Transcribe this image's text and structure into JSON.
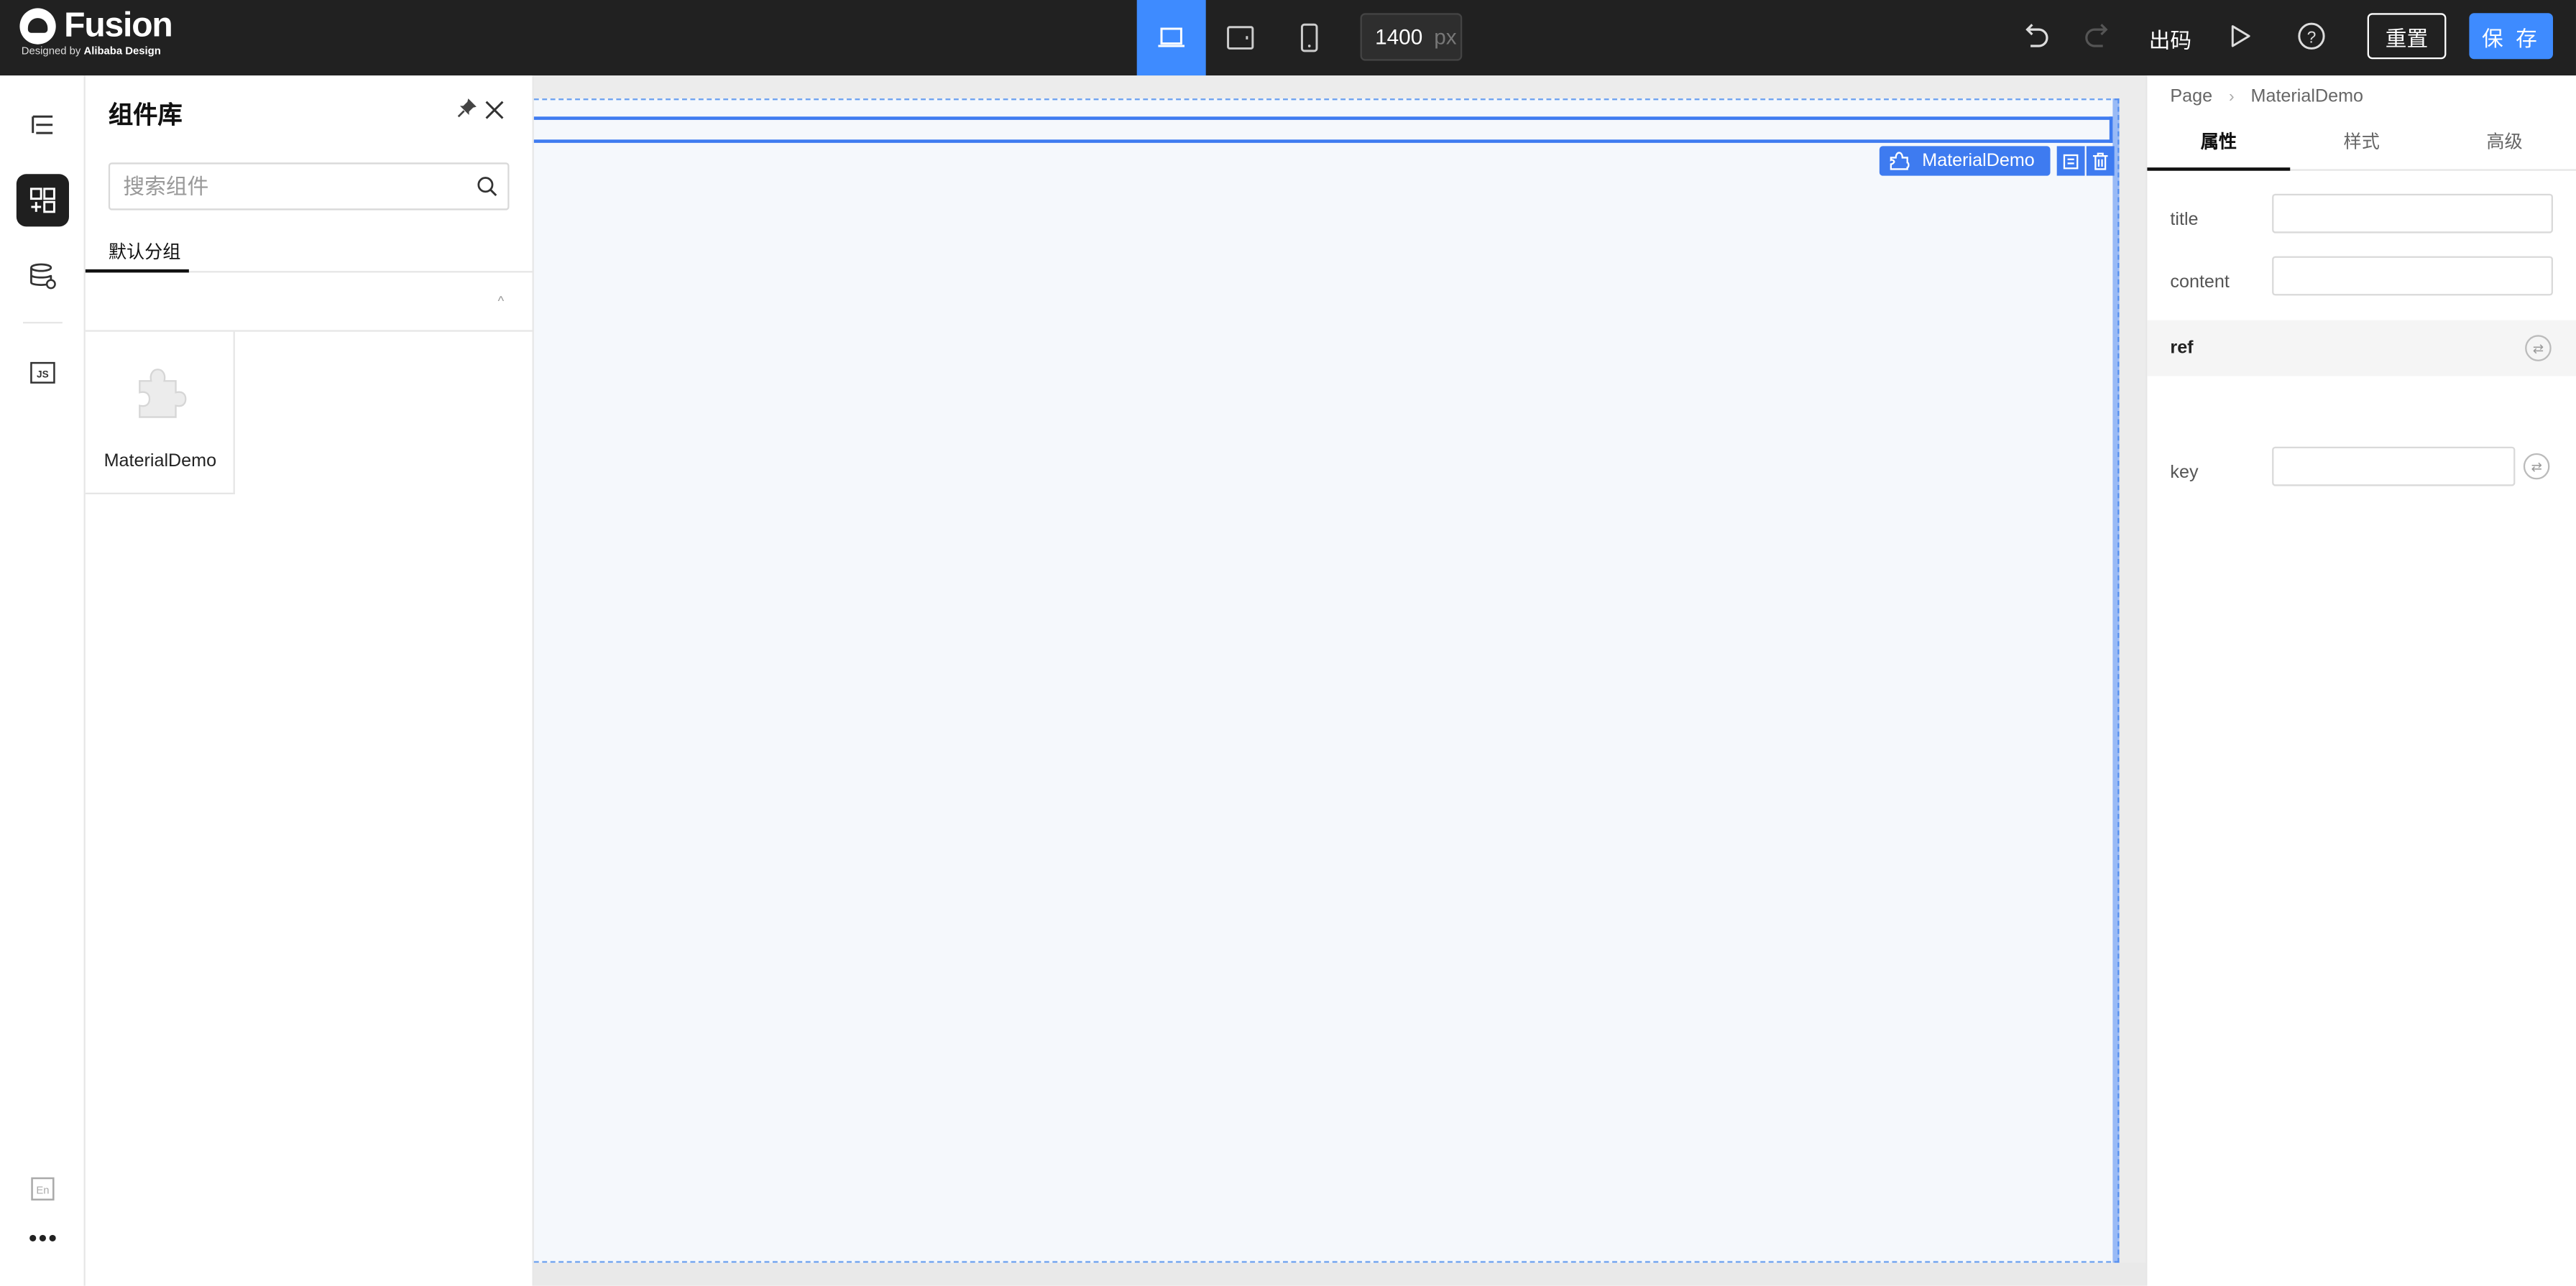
{
  "topbar": {
    "logo_text": "Fusion",
    "logo_sub_prefix": "Designed by ",
    "logo_sub_brand": "Alibaba Design",
    "devices": [
      "desktop",
      "tablet",
      "mobile"
    ],
    "width_value": "1400",
    "width_unit": "px",
    "export_code_label": "出码",
    "reset_label": "重置",
    "save_label": "保 存",
    "colors": {
      "bar": "#212121",
      "accent": "#3e8bff"
    }
  },
  "rail": {
    "items": [
      "outline-tree-icon",
      "component-library-icon",
      "datasource-icon",
      "js-icon"
    ],
    "bottom": [
      "language-en-icon",
      "more-icon"
    ],
    "js_label": "JS",
    "en_label": "En"
  },
  "panel": {
    "title": "组件库",
    "search_placeholder": "搜索组件",
    "tab_label": "默认分组",
    "components": [
      {
        "name": "MaterialDemo",
        "icon": "puzzle-icon"
      }
    ]
  },
  "canvas": {
    "selected_component": "MaterialDemo"
  },
  "settings": {
    "breadcrumb": [
      "Page",
      "MaterialDemo"
    ],
    "tabs": [
      "属性",
      "样式",
      "高级"
    ],
    "props": [
      {
        "label": "title",
        "value": ""
      },
      {
        "label": "content",
        "value": ""
      }
    ],
    "ref_label": "ref",
    "key_label": "key",
    "key_value": ""
  }
}
